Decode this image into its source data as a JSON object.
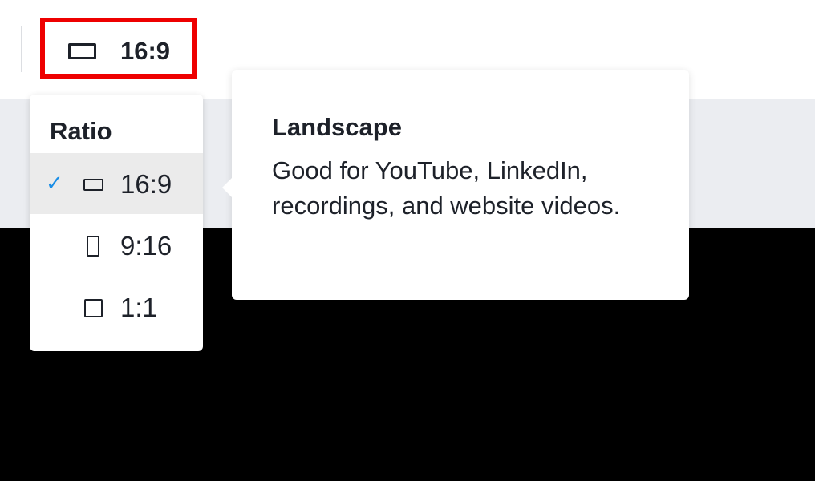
{
  "toolbar": {
    "ratio_button": {
      "label": "16:9",
      "icon": "landscape-rectangle-icon",
      "highlight_color": "#ee0000"
    }
  },
  "ratio_menu": {
    "heading": "Ratio",
    "selected_index": 0,
    "items": [
      {
        "label": "16:9",
        "icon": "landscape-rectangle-icon",
        "checked": true
      },
      {
        "label": "9:16",
        "icon": "portrait-rectangle-icon",
        "checked": false
      },
      {
        "label": "1:1",
        "icon": "square-icon",
        "checked": false
      }
    ],
    "check_glyph": "✓",
    "check_color": "#1a8ee6"
  },
  "tooltip": {
    "title": "Landscape",
    "body": "Good for YouTube, LinkedIn, recordings, and website videos."
  }
}
